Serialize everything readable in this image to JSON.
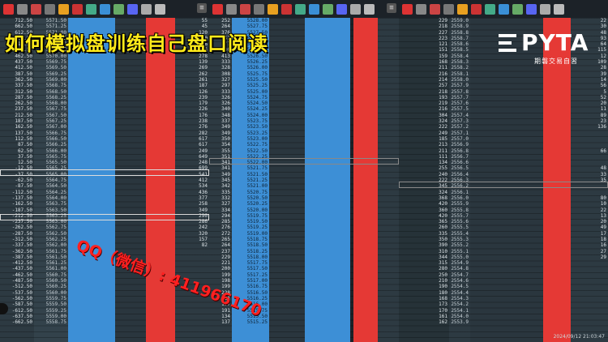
{
  "overlay": {
    "title": "如何模拟盘训练自己盘口阅读",
    "watermark": "QQ（微信）: 411966170",
    "timestamp": "2024/09/12 21:03:47"
  },
  "logo": {
    "brand": "PYTA",
    "tagline": "期磐交易自習"
  },
  "toolbar_icons": [
    "chart-icon",
    "note-icon",
    "scissors-icon",
    "doc-icon",
    "tag-icon",
    "alert-icon",
    "bars-icon",
    "s-icon",
    "layers-icon",
    "discord-icon",
    "pen-icon",
    "search-icon"
  ],
  "colors": {
    "background": "#263238",
    "ask_red": "#e53935",
    "bid_blue": "#3d8fd6",
    "title_yellow": "#ffeb1a",
    "watermark_red": "#ff2020"
  },
  "panel1": {
    "prices": [
      "712.50",
      "662.50",
      "612.50",
      "562.50",
      "512.50",
      "487.50",
      "462.50",
      "437.50",
      "412.50",
      "387.50",
      "362.50",
      "337.50",
      "312.50",
      "287.50",
      "262.50",
      "237.50",
      "212.50",
      "187.50",
      "162.50",
      "137.50",
      "112.50",
      "87.50",
      "62.50",
      "37.50",
      "12.50",
      "-12.50",
      "-37.50",
      "-62.50",
      "-87.50",
      "-112.50",
      "-137.50",
      "-162.50",
      "-187.50",
      "-212.50",
      "-237.50",
      "-262.50",
      "-287.50",
      "-312.50",
      "-337.50",
      "-362.50",
      "-387.50",
      "-412.50",
      "-437.50",
      "-462.50",
      "-487.50",
      "-512.50",
      "-537.50",
      "-562.50",
      "-587.50",
      "-612.50",
      "-637.50",
      "-662.50"
    ],
    "depth": [
      "5571.50",
      "5571.25",
      "5571.00",
      "5570.75",
      "5570.50",
      "5570.25",
      "5570.00",
      "5569.75",
      "5569.50",
      "5569.25",
      "5569.00",
      "5568.75",
      "5568.50",
      "5568.25",
      "5568.00",
      "5567.75",
      "5567.50",
      "5567.25",
      "5567.00",
      "5566.75",
      "5566.50",
      "5566.25",
      "5566.00",
      "5565.75",
      "5565.50",
      "5565.25",
      "5565.00",
      "5564.75",
      "5564.50",
      "5564.25",
      "5564.00",
      "5563.75",
      "5563.50",
      "5563.25",
      "5563.00",
      "5562.75",
      "5562.50",
      "5562.25",
      "5562.00",
      "5561.75",
      "5561.50",
      "5561.25",
      "5561.00",
      "5560.75",
      "5560.50",
      "5560.25",
      "5560.00",
      "5559.75",
      "5559.50",
      "5559.25",
      "5559.00",
      "5558.75"
    ],
    "right_vals": [
      "55",
      "45",
      "120",
      "30",
      "238",
      "196",
      "278",
      "139",
      "269",
      "262",
      "261",
      "187",
      "126",
      "239",
      "179",
      "226",
      "176",
      "238",
      "276",
      "282",
      "617",
      "617",
      "249",
      "649",
      "248",
      "699",
      "541",
      "412",
      "534",
      "436",
      "377",
      "258",
      "349",
      "290",
      "286",
      "242",
      "320",
      "157",
      "82",
      "",
      "",
      "",
      "",
      "",
      "",
      "",
      "",
      "",
      "",
      "",
      "",
      ""
    ]
  },
  "panel2": {
    "depth": [
      "5528.00",
      "5527.75",
      "5527.50",
      "5527.25",
      "5527.00",
      "5526.75",
      "5526.50",
      "5526.25",
      "5526.00",
      "5525.75",
      "5525.50",
      "5525.25",
      "5525.00",
      "5524.75",
      "5524.50",
      "5524.25",
      "5524.00",
      "5523.75",
      "5523.50",
      "5523.25",
      "5523.00",
      "5522.75",
      "5522.50",
      "5522.25",
      "5522.00",
      "5521.75",
      "5521.50",
      "5521.25",
      "5521.00",
      "5520.75",
      "5520.50",
      "5520.25",
      "5520.00",
      "5519.75",
      "5519.50",
      "5519.25",
      "5519.00",
      "5518.75",
      "5518.50",
      "5518.25",
      "5518.00",
      "5517.75",
      "5517.50",
      "5517.25",
      "5517.00",
      "5516.75",
      "5516.50",
      "5516.25",
      "5516.00",
      "5515.75",
      "5515.50",
      "5515.25"
    ],
    "counts": [
      "252",
      "264",
      "376",
      "267",
      "377",
      "330",
      "413",
      "333",
      "328",
      "308",
      "327",
      "297",
      "333",
      "326",
      "326",
      "340",
      "348",
      "337",
      "349",
      "349",
      "350",
      "354",
      "355",
      "351",
      "341",
      "341",
      "349",
      "345",
      "342",
      "335",
      "332",
      "327",
      "334",
      "294",
      "285",
      "276",
      "272",
      "265",
      "264",
      "237",
      "229",
      "221",
      "200",
      "199",
      "198",
      "199",
      "228",
      "211",
      "197",
      "191",
      "134",
      "137"
    ]
  },
  "panel3": {
    "counts": [
      "229",
      "218",
      "227",
      "223",
      "121",
      "151",
      "159",
      "168",
      "211",
      "216",
      "214",
      "257",
      "218",
      "193",
      "219",
      "216",
      "304",
      "324",
      "222",
      "249",
      "185",
      "213",
      "211",
      "111",
      "134",
      "255",
      "240",
      "222",
      "345",
      "324",
      "368",
      "420",
      "360",
      "420",
      "365",
      "260",
      "335",
      "350",
      "390",
      "310",
      "344",
      "315",
      "280",
      "250",
      "210",
      "190",
      "180",
      "168",
      "173",
      "170",
      "161",
      "162"
    ],
    "depth": [
      "2559.0",
      "2558.9",
      "2558.8",
      "2558.7",
      "2558.6",
      "2558.5",
      "2558.4",
      "2558.3",
      "2558.2",
      "2558.1",
      "2558.0",
      "2557.9",
      "2557.8",
      "2557.7",
      "2557.6",
      "2557.5",
      "2557.4",
      "2557.3",
      "2557.2",
      "2557.1",
      "2557.0",
      "2556.9",
      "2556.8",
      "2556.7",
      "2556.6",
      "2556.5",
      "2556.4",
      "2556.3",
      "2556.2",
      "2556.1",
      "2556.0",
      "2555.9",
      "2555.8",
      "2555.7",
      "2555.6",
      "2555.5",
      "2555.4",
      "2555.3",
      "2555.2",
      "2555.1",
      "2555.0",
      "2554.9",
      "2554.8",
      "2554.7",
      "2554.6",
      "2554.5",
      "2554.4",
      "2554.3",
      "2554.2",
      "2554.1",
      "2554.0",
      "2553.9"
    ],
    "right_vals": [
      "22",
      "30",
      "48",
      "93",
      "64",
      "115",
      "12",
      "109",
      "28",
      "39",
      "14",
      "56",
      "5",
      "52",
      "20",
      "11",
      "89",
      "23",
      "136",
      "",
      "",
      "",
      "66",
      "",
      "",
      "48",
      "33",
      "35",
      "",
      "",
      "80",
      "10",
      "22",
      "13",
      "20",
      "49",
      "17",
      "18",
      "16",
      "27",
      "29",
      "",
      "",
      "",
      "",
      "",
      "",
      "",
      "",
      "",
      "",
      ""
    ]
  }
}
